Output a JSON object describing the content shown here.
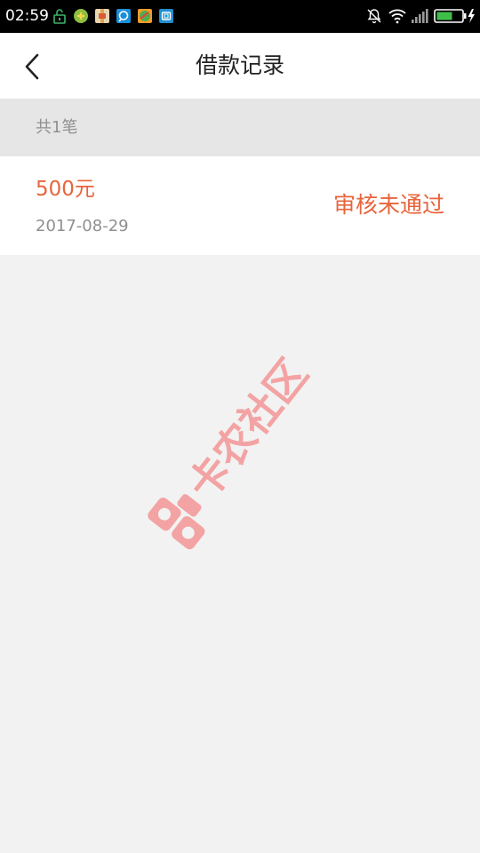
{
  "status_bar": {
    "time": "02:59",
    "notification_icons": [
      "lock-notification-icon",
      "leaf-app-icon",
      "package-app-icon",
      "chat-app-icon",
      "browser-app-icon",
      "screenshot-app-icon"
    ],
    "right_icons": [
      "mute-bell-icon",
      "wifi-icon",
      "signal-icon",
      "battery-charging-icon"
    ]
  },
  "header": {
    "title": "借款记录",
    "back_icon": "back-chevron-icon"
  },
  "summary": {
    "text": "共1笔"
  },
  "records": [
    {
      "amount": "500元",
      "date": "2017-08-29",
      "status": "审核未通过"
    }
  ],
  "watermark": {
    "text": "卡农社区",
    "icon": "watermark-logo-icon"
  },
  "colors": {
    "accent": "#e8643b",
    "secondary_text": "#8f8f8f",
    "background": "#f2f2f2",
    "summary_background": "#e6e6e6",
    "watermark": "#f3a3a3"
  }
}
